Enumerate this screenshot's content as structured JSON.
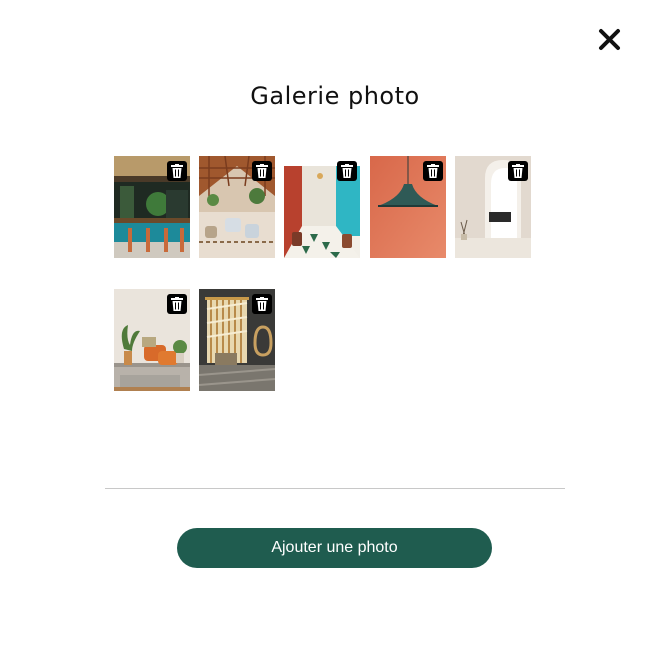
{
  "modal": {
    "title": "Galerie photo",
    "close_icon": "close-icon",
    "add_button_label": "Ajouter une photo",
    "accent_color": "#1f5c4f"
  },
  "gallery": {
    "delete_icon": "trash-icon",
    "photos": [
      {
        "name": "bar-interior-teal-counter"
      },
      {
        "name": "restaurant-wooden-roof"
      },
      {
        "name": "restaurant-checkered-floor"
      },
      {
        "name": "pendant-lamp-orange-wall"
      },
      {
        "name": "white-arch-minimal-room"
      },
      {
        "name": "living-room-plants-orange-sofa"
      },
      {
        "name": "lounge-wooden-screen-rattan-chair"
      }
    ]
  }
}
